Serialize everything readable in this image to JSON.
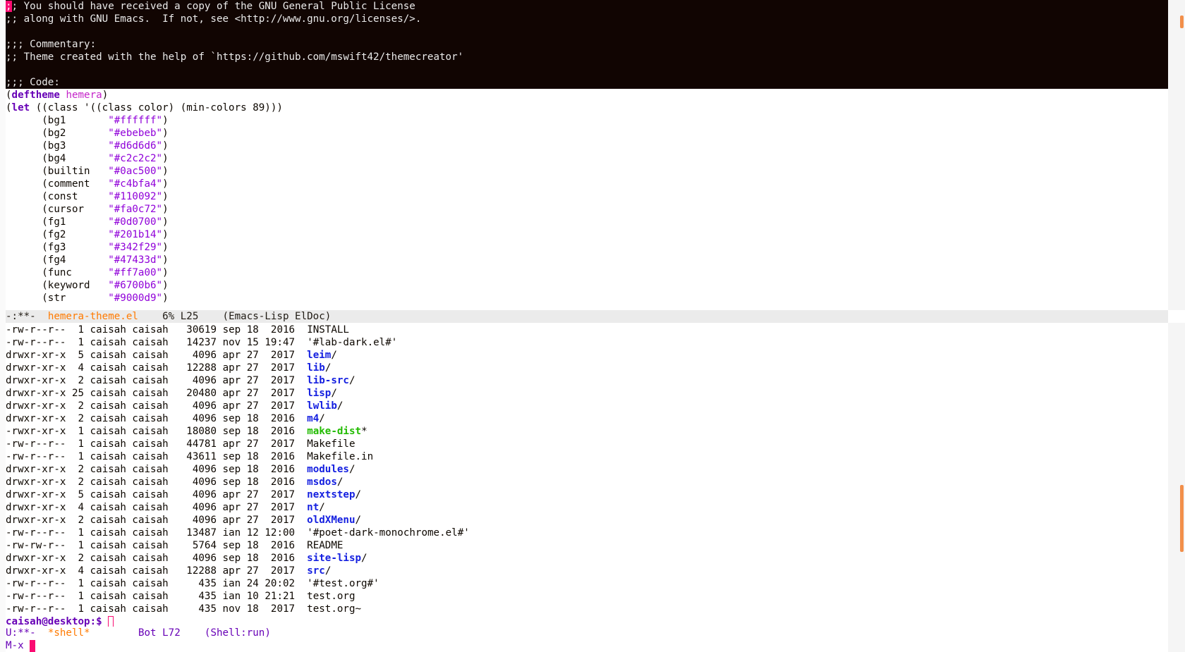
{
  "header_comment": [
    ";; You should have received a copy of the GNU General Public License",
    ";; along with GNU Emacs.  If not, see <http://www.gnu.org/licenses/>.",
    "",
    ";;; Commentary:",
    ";; Theme created with the help of `https://github.com/mswift42/themecreator'",
    "",
    ";;; Code:"
  ],
  "code": {
    "deftheme_kw": "deftheme",
    "theme_name": "hemera",
    "let_kw": "let",
    "let_rest": " ((class '((class color) (min-colors 89)))",
    "colors": [
      {
        "name": "bg1",
        "value": "\"#ffffff\""
      },
      {
        "name": "bg2",
        "value": "\"#ebebeb\""
      },
      {
        "name": "bg3",
        "value": "\"#d6d6d6\""
      },
      {
        "name": "bg4",
        "value": "\"#c2c2c2\""
      },
      {
        "name": "builtin",
        "value": "\"#0ac500\""
      },
      {
        "name": "comment",
        "value": "\"#c4bfa4\""
      },
      {
        "name": "const",
        "value": "\"#110092\""
      },
      {
        "name": "cursor",
        "value": "\"#fa0c72\""
      },
      {
        "name": "fg1",
        "value": "\"#0d0700\""
      },
      {
        "name": "fg2",
        "value": "\"#201b14\""
      },
      {
        "name": "fg3",
        "value": "\"#342f29\""
      },
      {
        "name": "fg4",
        "value": "\"#47433d\""
      },
      {
        "name": "func",
        "value": "\"#ff7a00\""
      },
      {
        "name": "keyword",
        "value": "\"#6700b6\""
      },
      {
        "name": "str",
        "value": "\"#9000d9\""
      }
    ]
  },
  "modeline_top": {
    "status": "-:**-",
    "buffer": "hemera-theme.el",
    "position": "6% L25",
    "modes": "(Emacs-Lisp ElDoc)"
  },
  "listing": [
    {
      "perm": "-rw-r--r--",
      "links": "1",
      "owner": "caisah",
      "group": "caisah",
      "size": "30619",
      "month": "sep",
      "day": "18",
      "time": "2016",
      "name": "INSTALL",
      "kind": "file",
      "suffix": ""
    },
    {
      "perm": "-rw-r--r--",
      "links": "1",
      "owner": "caisah",
      "group": "caisah",
      "size": "14237",
      "month": "nov",
      "day": "15",
      "time": "19:47",
      "name": "'#lab-dark.el#'",
      "kind": "file",
      "suffix": ""
    },
    {
      "perm": "drwxr-xr-x",
      "links": "5",
      "owner": "caisah",
      "group": "caisah",
      "size": "4096",
      "month": "apr",
      "day": "27",
      "time": "2017",
      "name": "leim",
      "kind": "dir",
      "suffix": "/"
    },
    {
      "perm": "drwxr-xr-x",
      "links": "4",
      "owner": "caisah",
      "group": "caisah",
      "size": "12288",
      "month": "apr",
      "day": "27",
      "time": "2017",
      "name": "lib",
      "kind": "dir",
      "suffix": "/"
    },
    {
      "perm": "drwxr-xr-x",
      "links": "2",
      "owner": "caisah",
      "group": "caisah",
      "size": "4096",
      "month": "apr",
      "day": "27",
      "time": "2017",
      "name": "lib-src",
      "kind": "dir",
      "suffix": "/"
    },
    {
      "perm": "drwxr-xr-x",
      "links": "25",
      "owner": "caisah",
      "group": "caisah",
      "size": "20480",
      "month": "apr",
      "day": "27",
      "time": "2017",
      "name": "lisp",
      "kind": "dir",
      "suffix": "/"
    },
    {
      "perm": "drwxr-xr-x",
      "links": "2",
      "owner": "caisah",
      "group": "caisah",
      "size": "4096",
      "month": "apr",
      "day": "27",
      "time": "2017",
      "name": "lwlib",
      "kind": "dir",
      "suffix": "/"
    },
    {
      "perm": "drwxr-xr-x",
      "links": "2",
      "owner": "caisah",
      "group": "caisah",
      "size": "4096",
      "month": "sep",
      "day": "18",
      "time": "2016",
      "name": "m4",
      "kind": "dir",
      "suffix": "/"
    },
    {
      "perm": "-rwxr-xr-x",
      "links": "1",
      "owner": "caisah",
      "group": "caisah",
      "size": "18080",
      "month": "sep",
      "day": "18",
      "time": "2016",
      "name": "make-dist",
      "kind": "exe",
      "suffix": "*"
    },
    {
      "perm": "-rw-r--r--",
      "links": "1",
      "owner": "caisah",
      "group": "caisah",
      "size": "44781",
      "month": "apr",
      "day": "27",
      "time": "2017",
      "name": "Makefile",
      "kind": "file",
      "suffix": ""
    },
    {
      "perm": "-rw-r--r--",
      "links": "1",
      "owner": "caisah",
      "group": "caisah",
      "size": "43611",
      "month": "sep",
      "day": "18",
      "time": "2016",
      "name": "Makefile.in",
      "kind": "file",
      "suffix": ""
    },
    {
      "perm": "drwxr-xr-x",
      "links": "2",
      "owner": "caisah",
      "group": "caisah",
      "size": "4096",
      "month": "sep",
      "day": "18",
      "time": "2016",
      "name": "modules",
      "kind": "dir",
      "suffix": "/"
    },
    {
      "perm": "drwxr-xr-x",
      "links": "2",
      "owner": "caisah",
      "group": "caisah",
      "size": "4096",
      "month": "sep",
      "day": "18",
      "time": "2016",
      "name": "msdos",
      "kind": "dir",
      "suffix": "/"
    },
    {
      "perm": "drwxr-xr-x",
      "links": "5",
      "owner": "caisah",
      "group": "caisah",
      "size": "4096",
      "month": "apr",
      "day": "27",
      "time": "2017",
      "name": "nextstep",
      "kind": "dir",
      "suffix": "/"
    },
    {
      "perm": "drwxr-xr-x",
      "links": "4",
      "owner": "caisah",
      "group": "caisah",
      "size": "4096",
      "month": "apr",
      "day": "27",
      "time": "2017",
      "name": "nt",
      "kind": "dir",
      "suffix": "/"
    },
    {
      "perm": "drwxr-xr-x",
      "links": "2",
      "owner": "caisah",
      "group": "caisah",
      "size": "4096",
      "month": "apr",
      "day": "27",
      "time": "2017",
      "name": "oldXMenu",
      "kind": "dir",
      "suffix": "/"
    },
    {
      "perm": "-rw-r--r--",
      "links": "1",
      "owner": "caisah",
      "group": "caisah",
      "size": "13487",
      "month": "ian",
      "day": "12",
      "time": "12:00",
      "name": "'#poet-dark-monochrome.el#'",
      "kind": "file",
      "suffix": ""
    },
    {
      "perm": "-rw-rw-r--",
      "links": "1",
      "owner": "caisah",
      "group": "caisah",
      "size": "5764",
      "month": "sep",
      "day": "18",
      "time": "2016",
      "name": "README",
      "kind": "file",
      "suffix": ""
    },
    {
      "perm": "drwxr-xr-x",
      "links": "2",
      "owner": "caisah",
      "group": "caisah",
      "size": "4096",
      "month": "sep",
      "day": "18",
      "time": "2016",
      "name": "site-lisp",
      "kind": "dir",
      "suffix": "/"
    },
    {
      "perm": "drwxr-xr-x",
      "links": "4",
      "owner": "caisah",
      "group": "caisah",
      "size": "12288",
      "month": "apr",
      "day": "27",
      "time": "2017",
      "name": "src",
      "kind": "dir",
      "suffix": "/"
    },
    {
      "perm": "-rw-r--r--",
      "links": "1",
      "owner": "caisah",
      "group": "caisah",
      "size": "435",
      "month": "ian",
      "day": "24",
      "time": "20:02",
      "name": "'#test.org#'",
      "kind": "file",
      "suffix": ""
    },
    {
      "perm": "-rw-r--r--",
      "links": "1",
      "owner": "caisah",
      "group": "caisah",
      "size": "435",
      "month": "ian",
      "day": "10",
      "time": "21:21",
      "name": "test.org",
      "kind": "file",
      "suffix": ""
    },
    {
      "perm": "-rw-r--r--",
      "links": "1",
      "owner": "caisah",
      "group": "caisah",
      "size": "435",
      "month": "nov",
      "day": "18",
      "time": "2017",
      "name": "test.org~",
      "kind": "file",
      "suffix": ""
    }
  ],
  "shell_prompt": "caisah@desktop:$ ",
  "modeline_bottom": {
    "status": "U:**-",
    "buffer": "*shell*",
    "position": "Bot L72",
    "modes": "(Shell:run)"
  },
  "minibuffer": {
    "prompt": "M-x "
  },
  "colors": {
    "cursor": "#fa0c72",
    "keyword": "#6700b6",
    "string": "#9000d9",
    "directory": "#1520e0",
    "executable": "#22bb00",
    "func": "#ff7a00",
    "dark_bg": "#110502",
    "modeline_bg": "#ebebeb"
  }
}
